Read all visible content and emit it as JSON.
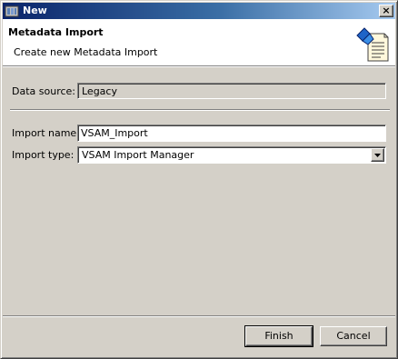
{
  "window": {
    "title": "New",
    "close_glyph": "×"
  },
  "banner": {
    "title": "Metadata Import",
    "description": "Create new Metadata Import",
    "icon": "import-wizard-icon"
  },
  "data_source": {
    "label": "Data source:",
    "value": "Legacy"
  },
  "import_name": {
    "label": "Import name:",
    "value": "VSAM_Import"
  },
  "import_type": {
    "label": "Import type:",
    "selected": "VSAM Import Manager"
  },
  "buttons": {
    "finish": "Finish",
    "cancel": "Cancel"
  }
}
